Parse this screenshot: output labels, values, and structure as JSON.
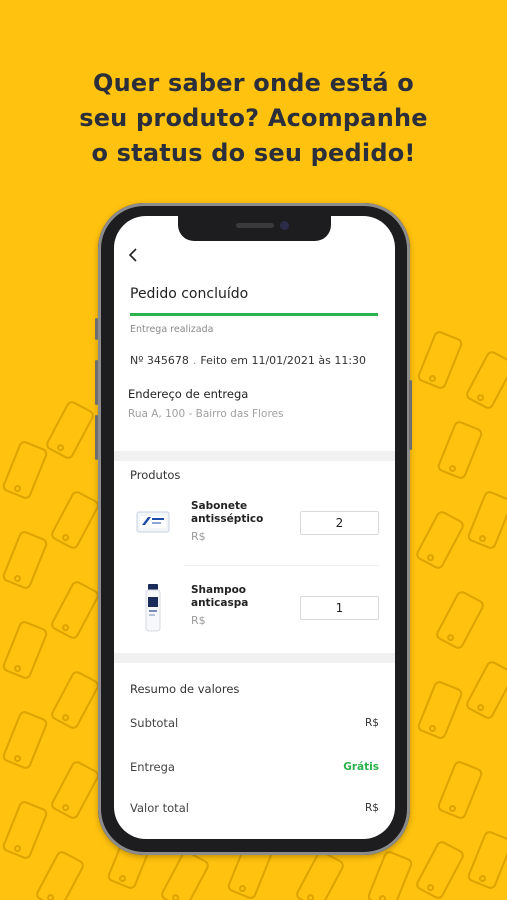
{
  "colors": {
    "background": "#FFC20E",
    "headline": "#2B2F3B",
    "accent_green": "#2BB24C"
  },
  "headline": [
    "Quer saber onde está o",
    "seu produto? Acompanhe",
    "o status do seu pedido!"
  ],
  "app": {
    "back_icon": "chevron-left-icon",
    "title": "Pedido concluído",
    "progress": 1.0,
    "status": "Entrega realizada",
    "order_number": "Nº 345678",
    "order_sep": ".",
    "order_date": "Feito em 11/01/2021 às 11:30",
    "address_label": "Endereço de entrega",
    "address": "Rua A, 100 - Bairro das Flores",
    "products_title": "Produtos",
    "products": [
      {
        "name": "Sabonete antisséptico",
        "price": "R$",
        "qty": "2",
        "image": "soap-box-image"
      },
      {
        "name": "Shampoo anticaspa",
        "price": "R$",
        "qty": "1",
        "image": "shampoo-bottle-image"
      }
    ],
    "summary_title": "Resumo de valores",
    "summary": [
      {
        "label": "Subtotal",
        "value": "R$"
      },
      {
        "label": "Entrega",
        "value": "Grátis"
      },
      {
        "label": "Valor total",
        "value": "R$"
      }
    ]
  }
}
